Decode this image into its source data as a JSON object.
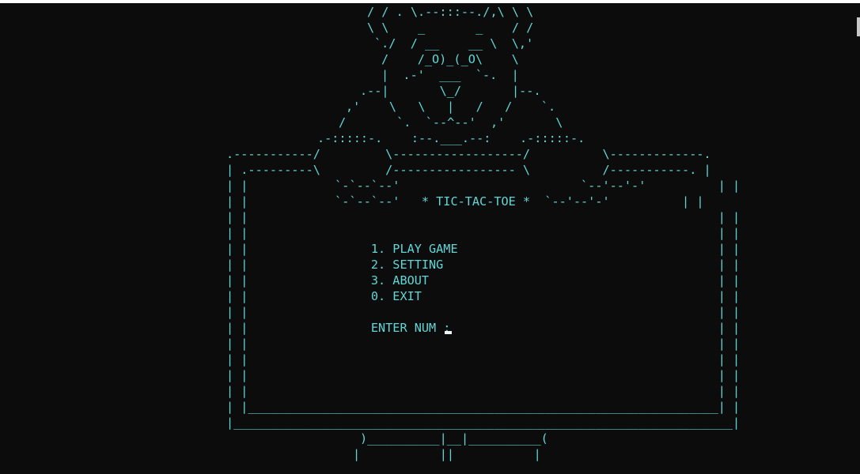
{
  "theme": {
    "background": "#0c0c0c",
    "text": "#61d6d6",
    "cursor": "#f2f2f2"
  },
  "art": {
    "l00": "/ / . \\.--:::--./,\\ \\ \\",
    "l01": "\\ \\    _       _    / /",
    "l02": "`./  / __    __ \\  \\,'",
    "l03": "/    /_O)_(_O\\    \\",
    "l04": "|  .-'  ___  `-.  |",
    "l05": ".--|       \\_/       |--.",
    "l06": ",'    \\   \\   |   /   /    `.",
    "l07": "/       `.  `--^--'  ,'       \\",
    "l08": ".-:::::-.    :--.___.--:    .-:::::-.",
    "l09": ".-----------/         \\------------------/          \\-------------.",
    "l10": "| .---------\\         /----------------- \\          /-----------. |",
    "l11": "| |            `-`--`--'                         `--'--'-'          | |",
    "l12": "| |            `-`--`--'   * TIC-TAC-TOE *  `--'--'-'          | |",
    "l13": "| |                                                                 | |",
    "l14": "| |                                                                 | |",
    "l15": "| |                 1. PLAY GAME                                    | |",
    "l16": "| |                 2. SETTING                                      | |",
    "l17": "| |                 3. ABOUT                                        | |",
    "l18": "| |                 0. EXIT                                         | |",
    "l19": "| |                                                                 | |",
    "l20": "| |                 ENTER NUM :                                     | |",
    "l21": "| |                                                                 | |",
    "l22": "| |                                                                 | |",
    "l23": "| |                                                                 | |",
    "l24": "| |                                                                 | |",
    "l25": "| |_________________________________________________________________| |",
    "l26": "|_____________________________________________________________________|",
    "l27": ")__________|__|__________(",
    "l28": "|           ||           |"
  }
}
